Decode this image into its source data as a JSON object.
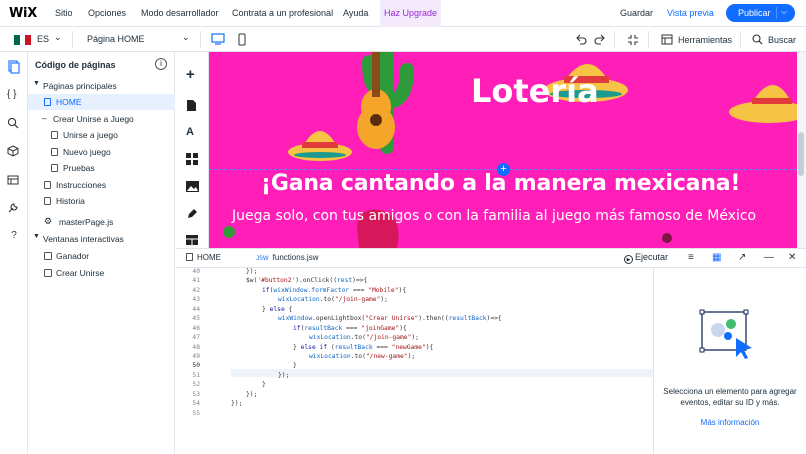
{
  "topbar": {
    "logo": "WiX",
    "menu": [
      "Sitio",
      "Opciones",
      "Modo desarrollador",
      "Contrata a un profesional",
      "Ayuda"
    ],
    "upgrade": "Haz Upgrade",
    "save": "Guardar",
    "preview": "Vista previa",
    "publish": "Publicar"
  },
  "toolbar": {
    "language": "ES",
    "page": "Página HOME",
    "tools": "Herramientas",
    "search": "Buscar"
  },
  "pages_panel": {
    "title": "Código de páginas",
    "main_section": "Páginas principales",
    "items": [
      {
        "label": "HOME",
        "selected": true
      },
      {
        "label": "Crear Unirse a Juego"
      },
      {
        "label": "Unirse a juego"
      },
      {
        "label": "Nuevo juego"
      },
      {
        "label": "Pruebas"
      },
      {
        "label": "Instrucciones"
      },
      {
        "label": "Historia"
      },
      {
        "label": "masterPage.js"
      }
    ],
    "lightbox_section": "Ventanas interactivas",
    "lightboxes": [
      "Ganador",
      "Crear Unirse"
    ]
  },
  "canvas": {
    "title": "Lotería",
    "headline": "¡Gana cantando a la manera mexicana!",
    "subhead": "Juega solo, con tus amigos o con la familia al juego más famoso de México",
    "bg_color": "#ff1fb8"
  },
  "code_panel": {
    "tabs": [
      {
        "icon": "page-icon",
        "label": "HOME"
      },
      {
        "icon": "JSW",
        "label": "functions.jsw"
      }
    ],
    "run": "Ejecutar",
    "line_numbers": [
      "40",
      "41",
      "42",
      "43",
      "44",
      "45",
      "46",
      "47",
      "48",
      "49",
      "50",
      "51",
      "52",
      "53",
      "54",
      "55"
    ],
    "current_line": "50"
  },
  "properties": {
    "message": "Selecciona un elemento para agregar eventos, editar su ID y más.",
    "link": "Más información"
  },
  "colors": {
    "accent": "#116dff",
    "upgrade": "#9a27d5",
    "canvas_pink": "#ff1fb8"
  }
}
